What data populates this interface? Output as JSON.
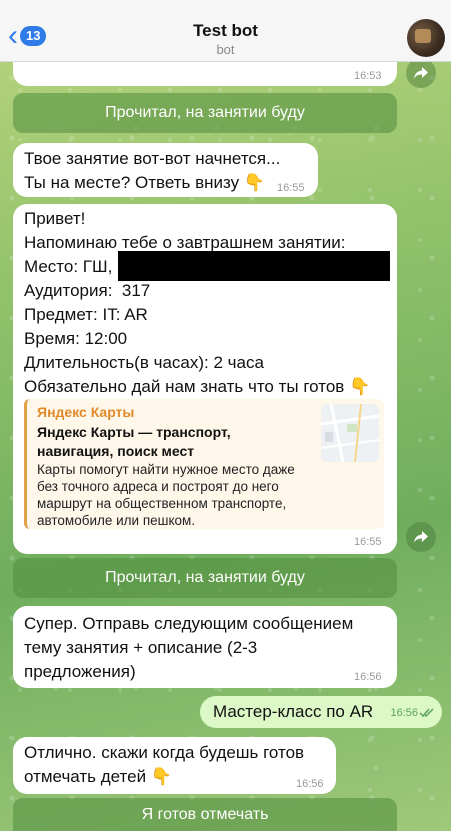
{
  "header": {
    "back_count": "13",
    "title": "Test bot",
    "subtitle": "bot"
  },
  "messages": {
    "m0_time": "16:53",
    "btn1": "Прочитал, на занятии буду",
    "m1_line1": "Твое занятие вот-вот начнется...",
    "m1_line2": "Ты на месте? Ответь внизу 👇",
    "m1_time": "16:55",
    "m2_lines": [
      "Привет!",
      "Напоминаю тебе о завтрашнем занятии:",
      "Место: ГШ,",
      "Аудитория:  317",
      "Предмет: IT: AR",
      "Время: 12:00",
      "Длительность(в часах): 2 часа",
      "Обязательно дай нам знать что ты готов 👇"
    ],
    "m2_time": "16:55",
    "preview": {
      "source": "Яндекс Карты",
      "title": "Яндекс Карты — транспорт, навигация, поиск мест",
      "description": "Карты помогут найти нужное место даже без точного адреса и построят до него маршрут на общественном транспорте, автомобиле или пешком."
    },
    "btn2": "Прочитал, на занятии буду",
    "m3_line1": "Супер. Отправь следующим сообщением",
    "m3_line2": "тему занятия + описание (2-3",
    "m3_line3": "предложения)",
    "m3_time": "16:56",
    "out_text": "Мастер-класс по AR",
    "out_time": "16:56",
    "m4_line1": "Отлично. скажи когда будешь готов",
    "m4_line2": "отмечать детей 👇",
    "m4_time": "16:56",
    "btn3": "Я готов отмечать"
  },
  "colors": {
    "accent": "#2f7be8",
    "outgoing_bubble": "#dcf8c6",
    "preview_source": "#e08a2a"
  }
}
